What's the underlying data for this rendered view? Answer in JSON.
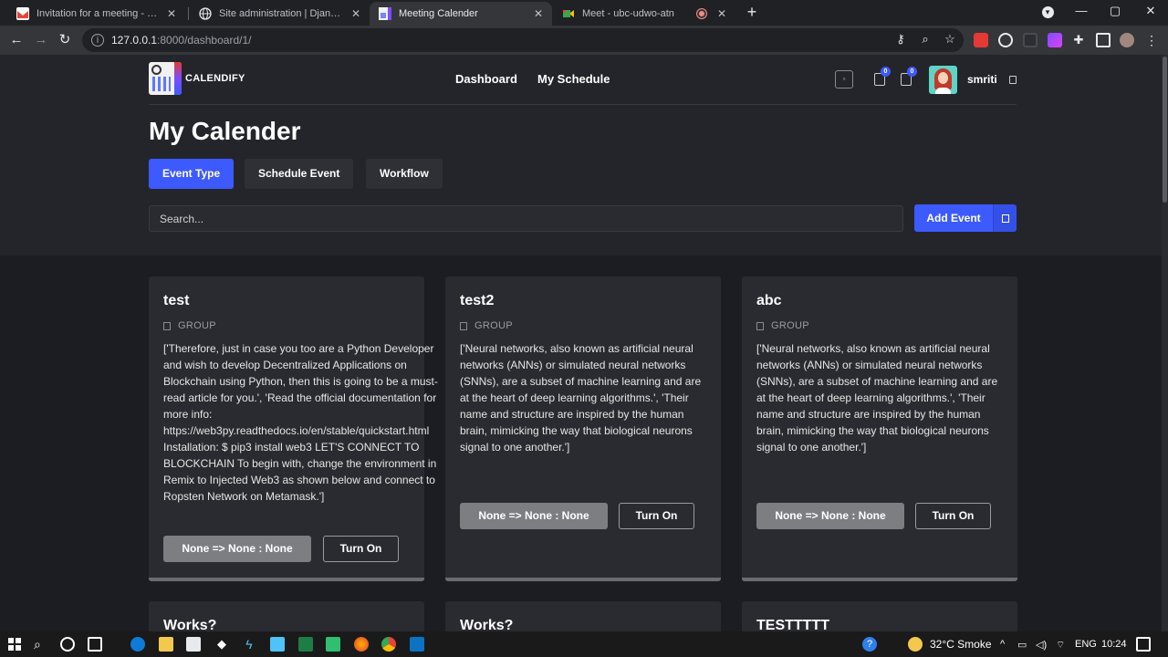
{
  "browser": {
    "tabs": [
      {
        "label": "Invitation for a meeting - aayush",
        "favicon": "gmail-icon",
        "favicon_color": "#ea4335"
      },
      {
        "label": "Site administration | Django site",
        "favicon": "globe-icon",
        "favicon_color": "#e8eaed"
      },
      {
        "label": "Meeting Calender",
        "favicon": "calendar-icon",
        "favicon_color": "#e8eaed"
      },
      {
        "label": "Meet - ubc-udwo-atn",
        "favicon": "meet-icon",
        "favicon_color": "#34a853"
      }
    ],
    "active_tab_index": 2,
    "new_tab_label": "+",
    "url_host": "127.0.0.1",
    "url_path": ":8000/dashboard/1/"
  },
  "app": {
    "brand": "CALENDIFY",
    "nav": {
      "dashboard": "Dashboard",
      "my_schedule": "My Schedule"
    },
    "notifications": {
      "first_count": "0",
      "second_count": "0"
    },
    "user": {
      "name": "smriti"
    },
    "accent_color": "#3d5afe"
  },
  "main": {
    "title": "My Calender",
    "tabs": [
      {
        "label": "Event Type",
        "active": true
      },
      {
        "label": "Schedule Event",
        "active": false
      },
      {
        "label": "Workflow",
        "active": false
      }
    ],
    "search_placeholder": "Search...",
    "add_event_label": "Add Event"
  },
  "cards": [
    {
      "title": "test",
      "group_label": "GROUP",
      "description": "['Therefore, just in case you too are a Python Developer and wish to develop Decentralized Applications on Blockchain using Python, then this is going to be a must-read article for you.', 'Read the official documentation for more info: https://web3py.readthedocs.io/en/stable/quickstart.html Installation: $ pip3 install web3 LET'S CONNECT TO BLOCKCHAIN To begin with, change the environment in Remix to Injected Web3 as shown below and connect to Ropsten Network on Metamask.']",
      "status_label": "None => None : None",
      "toggle_label": "Turn On"
    },
    {
      "title": "test2",
      "group_label": "GROUP",
      "description": "['Neural networks, also known as artificial neural networks (ANNs) or simulated neural networks (SNNs), are a subset of machine learning and are at the heart of deep learning algorithms.', 'Their name and structure are inspired by the human brain, mimicking the way that biological neurons signal to one another.']",
      "status_label": "None => None : None",
      "toggle_label": "Turn On"
    },
    {
      "title": "abc",
      "group_label": "GROUP",
      "description": "['Neural networks, also known as artificial neural networks (ANNs) or simulated neural networks (SNNs), are a subset of machine learning and are at the heart of deep learning algorithms.', 'Their name and structure are inspired by the human brain, mimicking the way that biological neurons signal to one another.']",
      "status_label": "None => None : None",
      "toggle_label": "Turn On"
    },
    {
      "title": "Works?"
    },
    {
      "title": "Works?"
    },
    {
      "title": "TESTTTTT"
    }
  ],
  "taskbar": {
    "weather": "32°C Smoke",
    "language": "ENG",
    "time": "10:24"
  }
}
